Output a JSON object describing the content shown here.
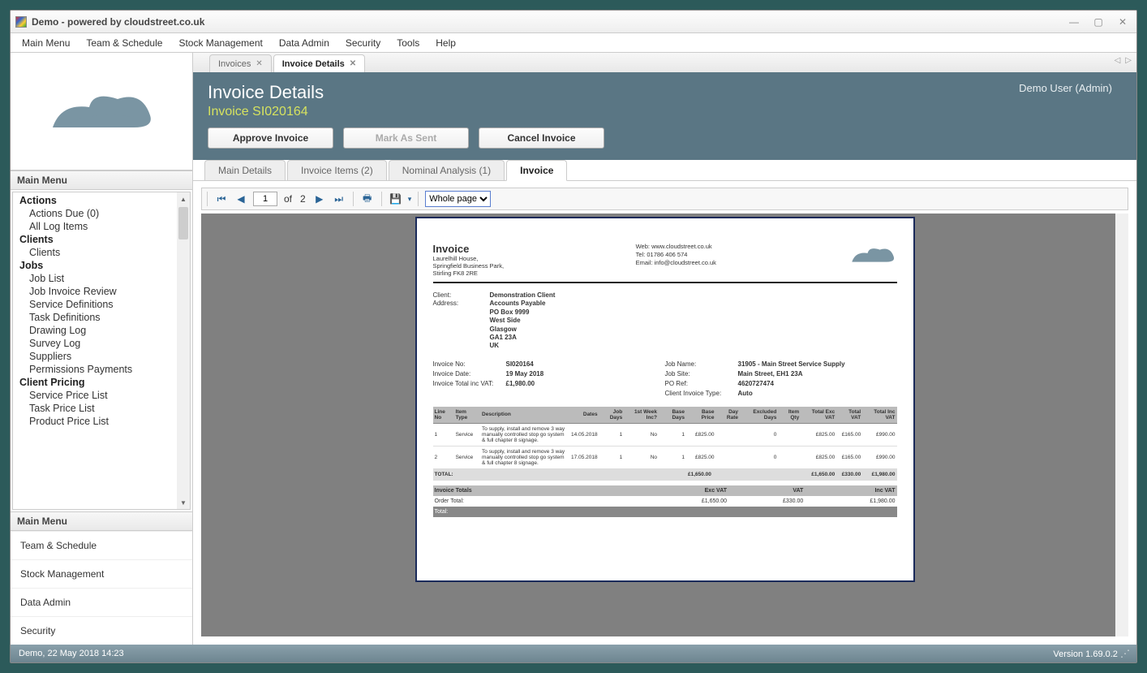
{
  "window": {
    "title": "Demo - powered by cloudstreet.co.uk"
  },
  "menubar": [
    "Main Menu",
    "Team & Schedule",
    "Stock Management",
    "Data Admin",
    "Security",
    "Tools",
    "Help"
  ],
  "sidebar": {
    "header": "Main Menu",
    "groups": [
      {
        "title": "Actions",
        "items": [
          "Actions Due (0)",
          "All Log Items"
        ]
      },
      {
        "title": "Clients",
        "items": [
          "Clients"
        ]
      },
      {
        "title": "Jobs",
        "items": [
          "Job List",
          "Job Invoice Review",
          "Service Definitions",
          "Task Definitions",
          "Drawing Log",
          "Survey Log",
          "Suppliers",
          "Permissions Payments"
        ]
      },
      {
        "title": "Client Pricing",
        "items": [
          "Service Price List",
          "Task Price List",
          "Product Price List"
        ]
      }
    ],
    "nav_header": "Main Menu",
    "nav": [
      "Team & Schedule",
      "Stock Management",
      "Data Admin",
      "Security"
    ]
  },
  "doc_tabs": [
    {
      "label": "Invoices",
      "active": false
    },
    {
      "label": "Invoice Details",
      "active": true
    }
  ],
  "header": {
    "title": "Invoice Details",
    "subtitle": "Invoice SI020164",
    "user": "Demo User (Admin)",
    "buttons": {
      "approve": "Approve Invoice",
      "mark": "Mark As Sent",
      "cancel": "Cancel Invoice"
    }
  },
  "sub_tabs": [
    "Main Details",
    "Invoice Items (2)",
    "Nominal Analysis (1)",
    "Invoice"
  ],
  "sub_tab_active": 3,
  "viewer": {
    "page": "1",
    "of": "of",
    "total": "2",
    "zoom": "Whole page"
  },
  "invoice": {
    "title": "Invoice",
    "company_addr": "Laurelhill House,\nSpringfield Business Park,\nStirling FK8 2RE",
    "contact": {
      "web": "Web: www.cloudstreet.co.uk",
      "tel": "Tel: 01786 406 574",
      "email": "Email: info@cloudstreet.co.uk"
    },
    "client_label": "Client:",
    "client": "Demonstration Client",
    "address_label": "Address:",
    "address": "Accounts Payable\nPO Box 9999\nWest Side\nGlasgow\nGA1 23A\nUK",
    "meta_left": [
      {
        "label": "Invoice No:",
        "value": "SI020164"
      },
      {
        "label": "Invoice Date:",
        "value": "19 May 2018"
      },
      {
        "label": "Invoice Total inc VAT:",
        "value": "£1,980.00"
      }
    ],
    "meta_right": [
      {
        "label": "Job Name:",
        "value": "31905 - Main Street Service Supply"
      },
      {
        "label": "Job Site:",
        "value": "Main Street, EH1 23A"
      },
      {
        "label": "PO Ref:",
        "value": "4620727474"
      },
      {
        "label": "Client Invoice Type:",
        "value": "Auto"
      }
    ],
    "cols": [
      "Line No",
      "Item Type",
      "Description",
      "Dates",
      "Job Days",
      "1st Week Inc?",
      "Base Days",
      "Base Price",
      "Day Rate",
      "Excluded Days",
      "Item Qty",
      "Total Exc VAT",
      "Total VAT",
      "Total Inc VAT"
    ],
    "rows": [
      {
        "no": "1",
        "type": "Service",
        "desc": "To supply, install and remove 3 way manually controlled stop go system & full chapter 8 signage.",
        "dates": "14.05.2018",
        "jobdays": "1",
        "wk": "No",
        "bdays": "1",
        "bprice": "£825.00",
        "rate": "",
        "excl": "0",
        "qty": "",
        "exvat": "£825.00",
        "vat": "£165.00",
        "incvat": "£990.00"
      },
      {
        "no": "2",
        "type": "Service",
        "desc": "To supply, install and remove 3 way manually controlled stop go system & full chapter 8 signage.",
        "dates": "17.05.2018",
        "jobdays": "1",
        "wk": "No",
        "bdays": "1",
        "bprice": "£825.00",
        "rate": "",
        "excl": "0",
        "qty": "",
        "exvat": "£825.00",
        "vat": "£165.00",
        "incvat": "£990.00"
      }
    ],
    "total_label": "TOTAL:",
    "totals": {
      "bprice": "£1,650.00",
      "exvat": "£1,650.00",
      "vat": "£330.00",
      "incvat": "£1,980.00"
    },
    "summary_header": [
      "Invoice Totals",
      "Exc VAT",
      "VAT",
      "Inc VAT"
    ],
    "order_total_label": "Order Total:",
    "summary_totals": {
      "exvat": "£1,650.00",
      "vat": "£330.00",
      "incvat": "£1,980.00"
    },
    "total_row_label": "Total:"
  },
  "status": {
    "left": "Demo, 22 May 2018 14:23",
    "right": "Version 1.69.0.2"
  }
}
